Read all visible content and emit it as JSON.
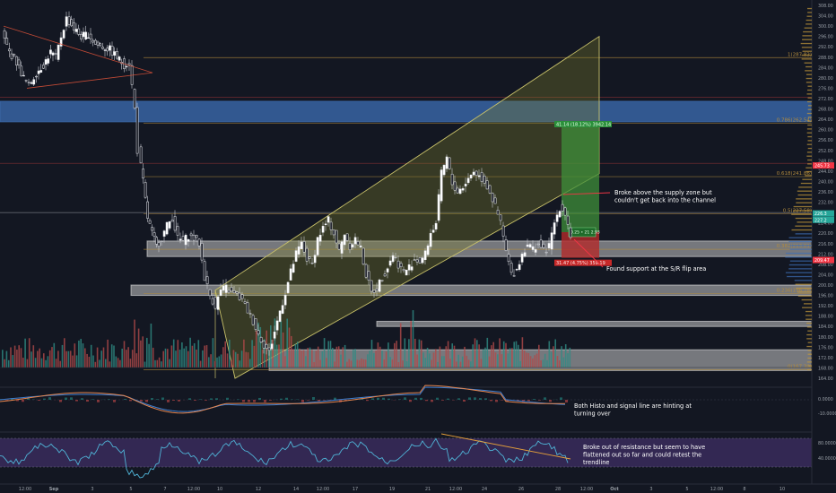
{
  "chart_data": [
    {
      "type": "candlestick",
      "panel": "price",
      "x_axis_labels": [
        "12:00",
        "Sep",
        "3",
        "5",
        "7",
        "12:00",
        "10",
        "12",
        "14",
        "12:00",
        "17",
        "19",
        "21",
        "12:00",
        "24",
        "26",
        "28",
        "12:00",
        "Oct",
        "3",
        "5",
        "12:00",
        "8",
        "10"
      ],
      "y_axis_ticks": [
        "308.00",
        "304.00",
        "300.00",
        "296.00",
        "292.00",
        "288.00",
        "284.00",
        "280.00",
        "276.00",
        "272.00",
        "268.00",
        "264.00",
        "260.00",
        "256.00",
        "252.00",
        "248.00",
        "244.00",
        "240.00",
        "236.00",
        "232.00",
        "228.00",
        "224.00",
        "220.00",
        "216.00",
        "212.00",
        "208.00",
        "204.00",
        "200.00",
        "196.00",
        "192.00",
        "188.00",
        "184.00",
        "180.00",
        "176.00",
        "172.00",
        "168.00",
        "164.00"
      ],
      "ylim": [
        162,
        310
      ],
      "close_series": [
        {
          "t": 0,
          "close": 297
        },
        {
          "t": 8,
          "close": 290
        },
        {
          "t": 16,
          "close": 286
        },
        {
          "t": 24,
          "close": 280
        },
        {
          "t": 30,
          "close": 277
        },
        {
          "t": 38,
          "close": 282
        },
        {
          "t": 46,
          "close": 285
        },
        {
          "t": 54,
          "close": 290
        },
        {
          "t": 60,
          "close": 288
        },
        {
          "t": 66,
          "close": 296
        },
        {
          "t": 72,
          "close": 303
        },
        {
          "t": 80,
          "close": 299
        },
        {
          "t": 88,
          "close": 296
        },
        {
          "t": 96,
          "close": 297
        },
        {
          "t": 104,
          "close": 293
        },
        {
          "t": 112,
          "close": 292
        },
        {
          "t": 120,
          "close": 291
        },
        {
          "t": 128,
          "close": 288
        },
        {
          "t": 136,
          "close": 285
        },
        {
          "t": 142,
          "close": 286
        },
        {
          "t": 148,
          "close": 268
        },
        {
          "t": 152,
          "close": 252
        },
        {
          "t": 157,
          "close": 240
        },
        {
          "t": 162,
          "close": 226
        },
        {
          "t": 167,
          "close": 220
        },
        {
          "t": 172,
          "close": 215
        },
        {
          "t": 178,
          "close": 218
        },
        {
          "t": 184,
          "close": 223
        },
        {
          "t": 190,
          "close": 226
        },
        {
          "t": 196,
          "close": 218
        },
        {
          "t": 202,
          "close": 217
        },
        {
          "t": 208,
          "close": 219
        },
        {
          "t": 214,
          "close": 218
        },
        {
          "t": 220,
          "close": 216
        },
        {
          "t": 226,
          "close": 203
        },
        {
          "t": 232,
          "close": 196
        },
        {
          "t": 238,
          "close": 192
        },
        {
          "t": 244,
          "close": 198
        },
        {
          "t": 250,
          "close": 199
        },
        {
          "t": 256,
          "close": 197
        },
        {
          "t": 262,
          "close": 196
        },
        {
          "t": 268,
          "close": 194
        },
        {
          "t": 274,
          "close": 190
        },
        {
          "t": 280,
          "close": 186
        },
        {
          "t": 286,
          "close": 181
        },
        {
          "t": 292,
          "close": 177
        },
        {
          "t": 298,
          "close": 174
        },
        {
          "t": 304,
          "close": 182
        },
        {
          "t": 310,
          "close": 190
        },
        {
          "t": 316,
          "close": 197
        },
        {
          "t": 322,
          "close": 205
        },
        {
          "t": 328,
          "close": 212
        },
        {
          "t": 334,
          "close": 216
        },
        {
          "t": 340,
          "close": 210
        },
        {
          "t": 346,
          "close": 208
        },
        {
          "t": 352,
          "close": 218
        },
        {
          "t": 358,
          "close": 222
        },
        {
          "t": 364,
          "close": 225
        },
        {
          "t": 370,
          "close": 220
        },
        {
          "t": 376,
          "close": 213
        },
        {
          "t": 382,
          "close": 220
        },
        {
          "t": 388,
          "close": 215
        },
        {
          "t": 394,
          "close": 218
        },
        {
          "t": 400,
          "close": 214
        },
        {
          "t": 406,
          "close": 204
        },
        {
          "t": 412,
          "close": 197
        },
        {
          "t": 418,
          "close": 199
        },
        {
          "t": 424,
          "close": 203
        },
        {
          "t": 430,
          "close": 207
        },
        {
          "t": 436,
          "close": 212
        },
        {
          "t": 442,
          "close": 208
        },
        {
          "t": 448,
          "close": 205
        },
        {
          "t": 454,
          "close": 207
        },
        {
          "t": 460,
          "close": 210
        },
        {
          "t": 466,
          "close": 209
        },
        {
          "t": 472,
          "close": 212
        },
        {
          "t": 478,
          "close": 220
        },
        {
          "t": 484,
          "close": 224
        },
        {
          "t": 490,
          "close": 243
        },
        {
          "t": 496,
          "close": 249
        },
        {
          "t": 502,
          "close": 239
        },
        {
          "t": 508,
          "close": 236
        },
        {
          "t": 514,
          "close": 238
        },
        {
          "t": 520,
          "close": 241
        },
        {
          "t": 526,
          "close": 244
        },
        {
          "t": 532,
          "close": 242
        },
        {
          "t": 538,
          "close": 240
        },
        {
          "t": 544,
          "close": 236
        },
        {
          "t": 550,
          "close": 230
        },
        {
          "t": 556,
          "close": 224
        },
        {
          "t": 562,
          "close": 213
        },
        {
          "t": 568,
          "close": 204
        },
        {
          "t": 574,
          "close": 206
        },
        {
          "t": 580,
          "close": 212
        },
        {
          "t": 586,
          "close": 216
        },
        {
          "t": 592,
          "close": 214
        },
        {
          "t": 598,
          "close": 216
        },
        {
          "t": 604,
          "close": 213
        },
        {
          "t": 610,
          "close": 215
        },
        {
          "t": 616,
          "close": 224
        },
        {
          "t": 622,
          "close": 230
        },
        {
          "t": 628,
          "close": 228
        },
        {
          "t": 634,
          "close": 219
        }
      ],
      "horizontal_levels": [
        {
          "label": "1(287.83)",
          "value": 287.83
        },
        {
          "label": "0.786(262.54)",
          "value": 262.54
        },
        {
          "label": "0.618(241.86)",
          "value": 241.86
        },
        {
          "label": "0.5(227.58)",
          "value": 227.58
        },
        {
          "label": "0.382(213.81)",
          "value": 213.81
        },
        {
          "label": "0.236(196.78)",
          "value": 196.78
        },
        {
          "label": "0(167.30)",
          "value": 167.3
        }
      ],
      "zones": [
        {
          "name": "supply zone",
          "from": 263,
          "to": 271
        },
        {
          "name": "S/R flip area",
          "from": 211,
          "to": 217
        },
        {
          "name": "support zone",
          "from": 196,
          "to": 200
        },
        {
          "name": "minor zone",
          "from": 184,
          "to": 186
        },
        {
          "name": "lower zone",
          "from": 167,
          "to": 175
        }
      ],
      "price_tags": [
        {
          "text": "226.3",
          "color": "#26a69a"
        },
        {
          "text": "227.2",
          "color": "#26a69a"
        },
        {
          "text": "245.73",
          "color": "#f23645"
        },
        {
          "text": "209.47",
          "color": "#f23645"
        }
      ],
      "trade": {
        "target_label": "41.14 (18.12%) 3942.14",
        "stop_label": "31.47 (4.75%) 359.19",
        "ratio_label": "0.25 • 21 2.93"
      },
      "annotations": [
        {
          "text_lines": [
            "Broke above the supply zone but",
            "couldn't get back into the channel"
          ]
        },
        {
          "text_lines": [
            "Found support at the S/R flip area"
          ]
        }
      ]
    },
    {
      "type": "line",
      "panel": "macd",
      "y_axis_ticks": [
        "0.0000",
        "-10.0000"
      ],
      "annotations": [
        {
          "text_lines": [
            "Both Histo and signal line are hinting at",
            "turning over"
          ]
        }
      ]
    },
    {
      "type": "line",
      "panel": "rsi",
      "y_axis_ticks": [
        "80.0000",
        "40.0000"
      ],
      "annotations": [
        {
          "text_lines": [
            "Broke out of resistance but seem to have",
            "flattened out so far and could retest the",
            "trendline"
          ]
        }
      ]
    }
  ],
  "colors": {
    "background": "#131722",
    "bull": "#d1d4dc",
    "bear": "#f0f3fa",
    "fib": "#b28b3d",
    "channel_fill": "#7a7a2a",
    "supply": "#3d6fb6",
    "zone": "#c8c8c8",
    "macd": "#3f7fd1",
    "signal": "#e6864e",
    "rsi": "#4fb3d6",
    "rsi_band": "#3a2c5c",
    "target_fill": "#3f8f3a",
    "stop_fill": "#b32b2b",
    "vol_up": "#2f8c84",
    "vol_down": "#b04a4a"
  }
}
